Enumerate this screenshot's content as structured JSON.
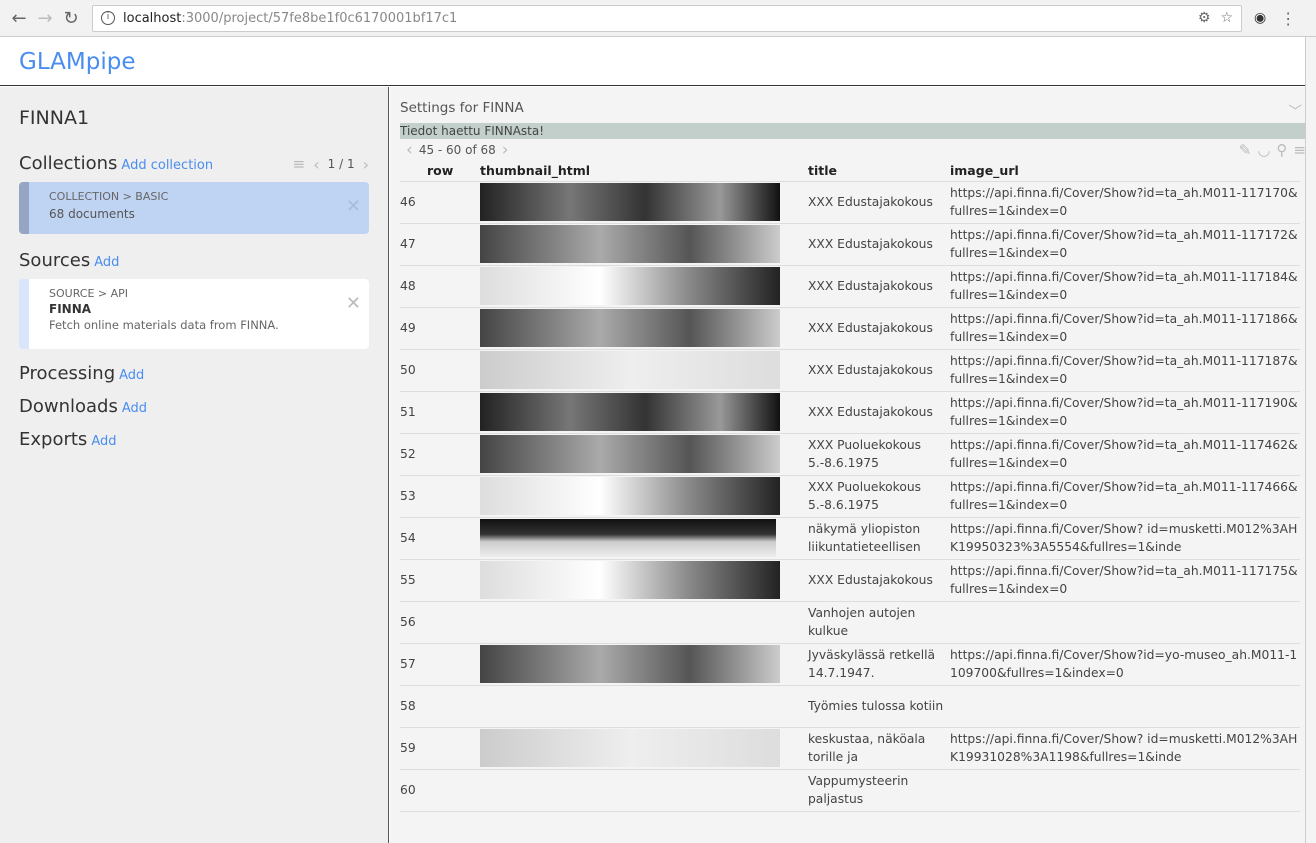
{
  "browser": {
    "url_host": "localhost",
    "url_path": ":3000/project/57fe8be1f0c6170001bf17c1"
  },
  "app": {
    "title": "GLAMpipe"
  },
  "sidebar": {
    "project": "FINNA1",
    "collections": {
      "label": "Collections",
      "add": "Add collection",
      "page": "1 / 1",
      "card": {
        "kind": "COLLECTION > BASIC",
        "count": "68 documents"
      }
    },
    "sources": {
      "label": "Sources",
      "add": "Add",
      "card": {
        "kind": "SOURCE > API",
        "title": "FINNA",
        "desc": "Fetch online materials data from FINNA."
      }
    },
    "processing": {
      "label": "Processing",
      "add": "Add"
    },
    "downloads": {
      "label": "Downloads",
      "add": "Add"
    },
    "exports": {
      "label": "Exports",
      "add": "Add"
    }
  },
  "main": {
    "settings_title": "Settings for FINNA",
    "message": "Tiedot haettu FINNAsta!",
    "range": "45 - 60 of 68",
    "columns": [
      "row",
      "thumbnail_html",
      "title",
      "image_url"
    ],
    "rows": [
      {
        "row": "46",
        "thumb": true,
        "title": "XXX Edustajakokous",
        "url": "https://api.finna.fi/Cover/Show?id=ta_ah.M011-117170&fullres=1&index=0"
      },
      {
        "row": "47",
        "thumb": true,
        "title": "XXX Edustajakokous",
        "url": "https://api.finna.fi/Cover/Show?id=ta_ah.M011-117172&fullres=1&index=0"
      },
      {
        "row": "48",
        "thumb": true,
        "title": "XXX Edustajakokous",
        "url": "https://api.finna.fi/Cover/Show?id=ta_ah.M011-117184&fullres=1&index=0"
      },
      {
        "row": "49",
        "thumb": true,
        "title": "XXX Edustajakokous",
        "url": "https://api.finna.fi/Cover/Show?id=ta_ah.M011-117186&fullres=1&index=0"
      },
      {
        "row": "50",
        "thumb": true,
        "title": "XXX Edustajakokous",
        "url": "https://api.finna.fi/Cover/Show?id=ta_ah.M011-117187&fullres=1&index=0"
      },
      {
        "row": "51",
        "thumb": true,
        "title": "XXX Edustajakokous",
        "url": "https://api.finna.fi/Cover/Show?id=ta_ah.M011-117190&fullres=1&index=0"
      },
      {
        "row": "52",
        "thumb": true,
        "title": "XXX Puoluekokous 5.-8.6.1975",
        "url": "https://api.finna.fi/Cover/Show?id=ta_ah.M011-117462&fullres=1&index=0"
      },
      {
        "row": "53",
        "thumb": true,
        "title": "XXX Puoluekokous 5.-8.6.1975",
        "url": "https://api.finna.fi/Cover/Show?id=ta_ah.M011-117466&fullres=1&index=0"
      },
      {
        "row": "54",
        "thumb": true,
        "title": "näkymä yliopiston liikuntatieteellisen",
        "url": "https://api.finna.fi/Cover/Show? id=musketti.M012%3AHK19950323%3A5554&fullres=1&inde"
      },
      {
        "row": "55",
        "thumb": true,
        "title": "XXX Edustajakokous",
        "url": "https://api.finna.fi/Cover/Show?id=ta_ah.M011-117175&fullres=1&index=0"
      },
      {
        "row": "56",
        "thumb": false,
        "title": "Vanhojen autojen kulkue",
        "url": ""
      },
      {
        "row": "57",
        "thumb": true,
        "title": "Jyväskylässä retkellä 14.7.1947.",
        "url": "https://api.finna.fi/Cover/Show?id=yo-museo_ah.M011-1109700&fullres=1&index=0"
      },
      {
        "row": "58",
        "thumb": false,
        "title": "Työmies tulossa kotiin",
        "url": ""
      },
      {
        "row": "59",
        "thumb": true,
        "title": "keskustaa, näköala torille ja",
        "url": "https://api.finna.fi/Cover/Show? id=musketti.M012%3AHK19931028%3A1198&fullres=1&inde"
      },
      {
        "row": "60",
        "thumb": false,
        "title": "Vappumysteerin paljastus",
        "url": ""
      }
    ]
  }
}
